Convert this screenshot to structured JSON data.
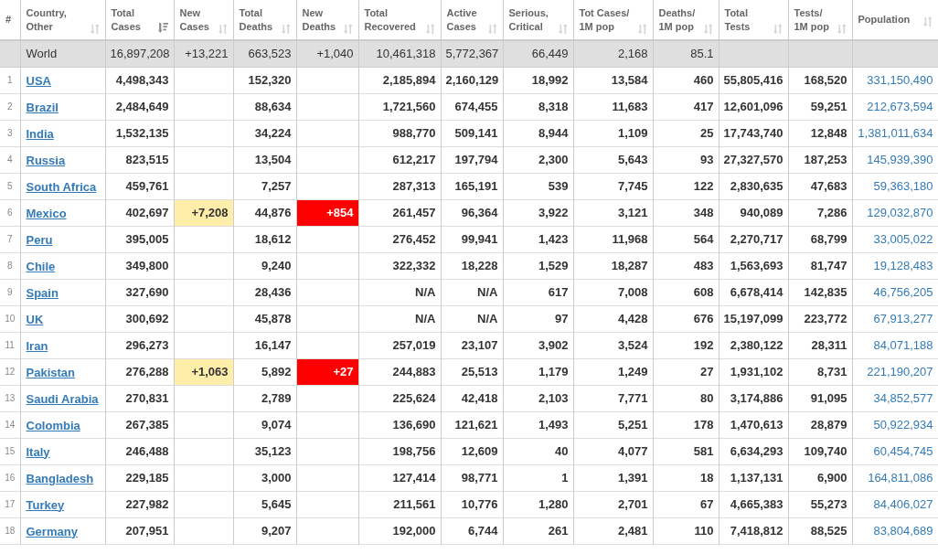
{
  "table": {
    "columns": [
      {
        "label": [
          "#"
        ],
        "kind": "rank"
      },
      {
        "label": [
          "Country,",
          "Other"
        ],
        "kind": "country",
        "sorted": false
      },
      {
        "label": [
          "Total",
          "Cases"
        ],
        "kind": "number",
        "sorted": true
      },
      {
        "label": [
          "New",
          "Cases"
        ],
        "kind": "new_cases",
        "sorted": false
      },
      {
        "label": [
          "Total",
          "Deaths"
        ],
        "kind": "number",
        "sorted": false
      },
      {
        "label": [
          "New",
          "Deaths"
        ],
        "kind": "new_deaths",
        "sorted": false
      },
      {
        "label": [
          "Total",
          "Recovered"
        ],
        "kind": "number",
        "sorted": false
      },
      {
        "label": [
          "Active",
          "Cases"
        ],
        "kind": "number",
        "sorted": false
      },
      {
        "label": [
          "Serious,",
          "Critical"
        ],
        "kind": "number",
        "sorted": false
      },
      {
        "label": [
          "Tot Cases/",
          "1M pop"
        ],
        "kind": "number",
        "sorted": false
      },
      {
        "label": [
          "Deaths/",
          "1M pop"
        ],
        "kind": "number",
        "sorted": false
      },
      {
        "label": [
          "Total",
          "Tests"
        ],
        "kind": "number",
        "sorted": false
      },
      {
        "label": [
          "Tests/",
          "1M pop"
        ],
        "kind": "number",
        "sorted": false
      },
      {
        "label": [
          "Population"
        ],
        "kind": "population",
        "sorted": false
      }
    ],
    "total_row": {
      "country": "World",
      "cells": {
        "total_cases": "16,897,208",
        "new_cases": "+13,221",
        "total_deaths": "663,523",
        "new_deaths": "+1,040",
        "total_recovered": "10,461,318",
        "active_cases": "5,772,367",
        "serious_critical": "66,449",
        "cases_per_1m": "2,168",
        "deaths_per_1m": "85.1"
      }
    },
    "rows": [
      {
        "rank": "1",
        "country": "USA",
        "cells": {
          "total_cases": "4,498,343",
          "total_deaths": "152,320",
          "total_recovered": "2,185,894",
          "active_cases": "2,160,129",
          "serious_critical": "18,992",
          "cases_per_1m": "13,584",
          "deaths_per_1m": "460",
          "total_tests": "55,805,416",
          "tests_per_1m": "168,520",
          "population": "331,150,490"
        }
      },
      {
        "rank": "2",
        "country": "Brazil",
        "cells": {
          "total_cases": "2,484,649",
          "total_deaths": "88,634",
          "total_recovered": "1,721,560",
          "active_cases": "674,455",
          "serious_critical": "8,318",
          "cases_per_1m": "11,683",
          "deaths_per_1m": "417",
          "total_tests": "12,601,096",
          "tests_per_1m": "59,251",
          "population": "212,673,594"
        }
      },
      {
        "rank": "3",
        "country": "India",
        "cells": {
          "total_cases": "1,532,135",
          "total_deaths": "34,224",
          "total_recovered": "988,770",
          "active_cases": "509,141",
          "serious_critical": "8,944",
          "cases_per_1m": "1,109",
          "deaths_per_1m": "25",
          "total_tests": "17,743,740",
          "tests_per_1m": "12,848",
          "population": "1,381,011,634"
        }
      },
      {
        "rank": "4",
        "country": "Russia",
        "cells": {
          "total_cases": "823,515",
          "total_deaths": "13,504",
          "total_recovered": "612,217",
          "active_cases": "197,794",
          "serious_critical": "2,300",
          "cases_per_1m": "5,643",
          "deaths_per_1m": "93",
          "total_tests": "27,327,570",
          "tests_per_1m": "187,253",
          "population": "145,939,390"
        }
      },
      {
        "rank": "5",
        "country": "South Africa",
        "cells": {
          "total_cases": "459,761",
          "total_deaths": "7,257",
          "total_recovered": "287,313",
          "active_cases": "165,191",
          "serious_critical": "539",
          "cases_per_1m": "7,745",
          "deaths_per_1m": "122",
          "total_tests": "2,830,635",
          "tests_per_1m": "47,683",
          "population": "59,363,180"
        }
      },
      {
        "rank": "6",
        "country": "Mexico",
        "cells": {
          "total_cases": "402,697",
          "new_cases": "+7,208",
          "total_deaths": "44,876",
          "new_deaths": "+854",
          "total_recovered": "261,457",
          "active_cases": "96,364",
          "serious_critical": "3,922",
          "cases_per_1m": "3,121",
          "deaths_per_1m": "348",
          "total_tests": "940,089",
          "tests_per_1m": "7,286",
          "population": "129,032,870"
        }
      },
      {
        "rank": "7",
        "country": "Peru",
        "cells": {
          "total_cases": "395,005",
          "total_deaths": "18,612",
          "total_recovered": "276,452",
          "active_cases": "99,941",
          "serious_critical": "1,423",
          "cases_per_1m": "11,968",
          "deaths_per_1m": "564",
          "total_tests": "2,270,717",
          "tests_per_1m": "68,799",
          "population": "33,005,022"
        }
      },
      {
        "rank": "8",
        "country": "Chile",
        "cells": {
          "total_cases": "349,800",
          "total_deaths": "9,240",
          "total_recovered": "322,332",
          "active_cases": "18,228",
          "serious_critical": "1,529",
          "cases_per_1m": "18,287",
          "deaths_per_1m": "483",
          "total_tests": "1,563,693",
          "tests_per_1m": "81,747",
          "population": "19,128,483"
        }
      },
      {
        "rank": "9",
        "country": "Spain",
        "cells": {
          "total_cases": "327,690",
          "total_deaths": "28,436",
          "total_recovered": "N/A",
          "active_cases": "N/A",
          "serious_critical": "617",
          "cases_per_1m": "7,008",
          "deaths_per_1m": "608",
          "total_tests": "6,678,414",
          "tests_per_1m": "142,835",
          "population": "46,756,205"
        }
      },
      {
        "rank": "10",
        "country": "UK",
        "cells": {
          "total_cases": "300,692",
          "total_deaths": "45,878",
          "total_recovered": "N/A",
          "active_cases": "N/A",
          "serious_critical": "97",
          "cases_per_1m": "4,428",
          "deaths_per_1m": "676",
          "total_tests": "15,197,099",
          "tests_per_1m": "223,772",
          "population": "67,913,277"
        }
      },
      {
        "rank": "11",
        "country": "Iran",
        "cells": {
          "total_cases": "296,273",
          "total_deaths": "16,147",
          "total_recovered": "257,019",
          "active_cases": "23,107",
          "serious_critical": "3,902",
          "cases_per_1m": "3,524",
          "deaths_per_1m": "192",
          "total_tests": "2,380,122",
          "tests_per_1m": "28,311",
          "population": "84,071,188"
        }
      },
      {
        "rank": "12",
        "country": "Pakistan",
        "cells": {
          "total_cases": "276,288",
          "new_cases": "+1,063",
          "total_deaths": "5,892",
          "new_deaths": "+27",
          "total_recovered": "244,883",
          "active_cases": "25,513",
          "serious_critical": "1,179",
          "cases_per_1m": "1,249",
          "deaths_per_1m": "27",
          "total_tests": "1,931,102",
          "tests_per_1m": "8,731",
          "population": "221,190,207"
        }
      },
      {
        "rank": "13",
        "country": "Saudi Arabia",
        "cells": {
          "total_cases": "270,831",
          "total_deaths": "2,789",
          "total_recovered": "225,624",
          "active_cases": "42,418",
          "serious_critical": "2,103",
          "cases_per_1m": "7,771",
          "deaths_per_1m": "80",
          "total_tests": "3,174,886",
          "tests_per_1m": "91,095",
          "population": "34,852,577"
        }
      },
      {
        "rank": "14",
        "country": "Colombia",
        "cells": {
          "total_cases": "267,385",
          "total_deaths": "9,074",
          "total_recovered": "136,690",
          "active_cases": "121,621",
          "serious_critical": "1,493",
          "cases_per_1m": "5,251",
          "deaths_per_1m": "178",
          "total_tests": "1,470,613",
          "tests_per_1m": "28,879",
          "population": "50,922,934"
        }
      },
      {
        "rank": "15",
        "country": "Italy",
        "cells": {
          "total_cases": "246,488",
          "total_deaths": "35,123",
          "total_recovered": "198,756",
          "active_cases": "12,609",
          "serious_critical": "40",
          "cases_per_1m": "4,077",
          "deaths_per_1m": "581",
          "total_tests": "6,634,293",
          "tests_per_1m": "109,740",
          "population": "60,454,745"
        }
      },
      {
        "rank": "16",
        "country": "Bangladesh",
        "cells": {
          "total_cases": "229,185",
          "total_deaths": "3,000",
          "total_recovered": "127,414",
          "active_cases": "98,771",
          "serious_critical": "1",
          "cases_per_1m": "1,391",
          "deaths_per_1m": "18",
          "total_tests": "1,137,131",
          "tests_per_1m": "6,900",
          "population": "164,811,086"
        }
      },
      {
        "rank": "17",
        "country": "Turkey",
        "cells": {
          "total_cases": "227,982",
          "total_deaths": "5,645",
          "total_recovered": "211,561",
          "active_cases": "10,776",
          "serious_critical": "1,280",
          "cases_per_1m": "2,701",
          "deaths_per_1m": "67",
          "total_tests": "4,665,383",
          "tests_per_1m": "55,273",
          "population": "84,406,027"
        }
      },
      {
        "rank": "18",
        "country": "Germany",
        "cells": {
          "total_cases": "207,951",
          "total_deaths": "9,207",
          "total_recovered": "192,000",
          "active_cases": "6,744",
          "serious_critical": "261",
          "cases_per_1m": "2,481",
          "deaths_per_1m": "110",
          "total_tests": "7,418,812",
          "tests_per_1m": "88,525",
          "population": "83,804,689"
        }
      }
    ]
  }
}
